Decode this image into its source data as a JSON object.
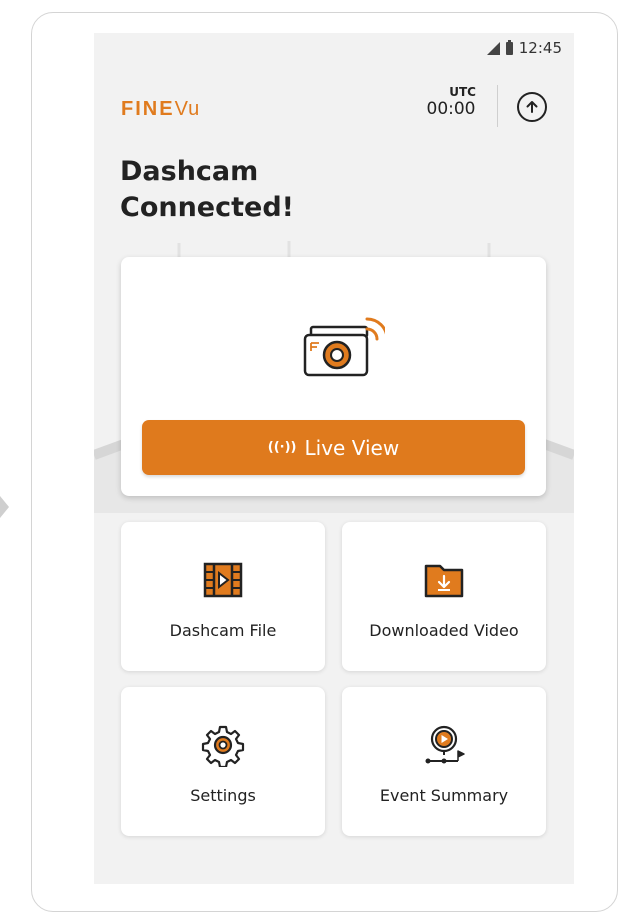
{
  "status": {
    "time": "12:45"
  },
  "header": {
    "brand_fine": "FINE",
    "brand_vu": "Vu",
    "utc_label": "UTC",
    "utc_time": "00:00"
  },
  "headline": {
    "line1": "Dashcam",
    "line2": "Connected!"
  },
  "hero": {
    "live_label": "Live View",
    "live_icon": "((·))"
  },
  "tiles": [
    {
      "label": "Dashcam File",
      "icon": "film-icon"
    },
    {
      "label": "Downloaded Video",
      "icon": "download-folder-icon"
    },
    {
      "label": "Settings",
      "icon": "gear-icon"
    },
    {
      "label": "Event Summary",
      "icon": "event-route-icon"
    }
  ],
  "colors": {
    "accent": "#df7a1d",
    "background": "#f2f2f2",
    "text": "#222222"
  }
}
